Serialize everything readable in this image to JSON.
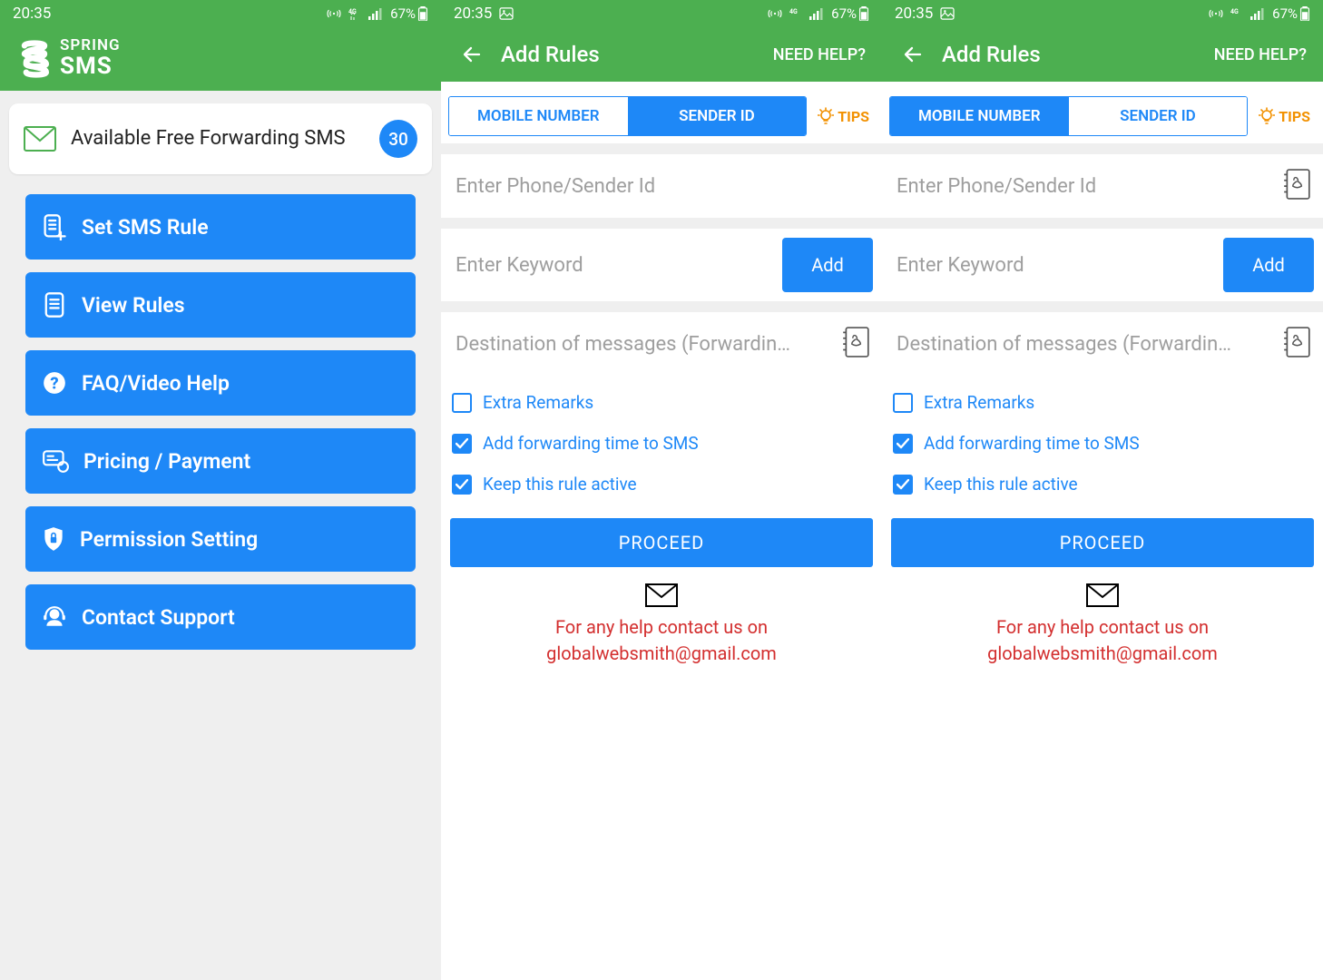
{
  "status": {
    "time": "20:35",
    "battery": "67%"
  },
  "s1": {
    "brand_line1": "SPRING",
    "brand_line2": "SMS",
    "card_text": "Available Free Forwarding SMS",
    "badge": "30",
    "menu": {
      "set_rule": "Set SMS Rule",
      "view_rules": "View Rules",
      "faq": "FAQ/Video Help",
      "pricing": "Pricing / Payment",
      "permission": "Permission Setting",
      "contact": "Contact Support"
    }
  },
  "appbar": {
    "title": "Add Rules",
    "help": "NEED HELP?"
  },
  "tabs": {
    "mobile": "MOBILE NUMBER",
    "sender": "SENDER ID",
    "tips": "TIPS"
  },
  "inputs": {
    "phone_ph": "Enter Phone/Sender Id",
    "keyword_ph": "Enter Keyword",
    "add_btn": "Add",
    "dest_ph": "Destination of messages (Forwardin…"
  },
  "checks": {
    "extra": "Extra Remarks",
    "fwd_time": "Add forwarding time to SMS",
    "active": "Keep this rule active"
  },
  "proceed": "PROCEED",
  "help_text": {
    "line1": "For any help contact us on",
    "line2": "globalwebsmith@gmail.com"
  }
}
